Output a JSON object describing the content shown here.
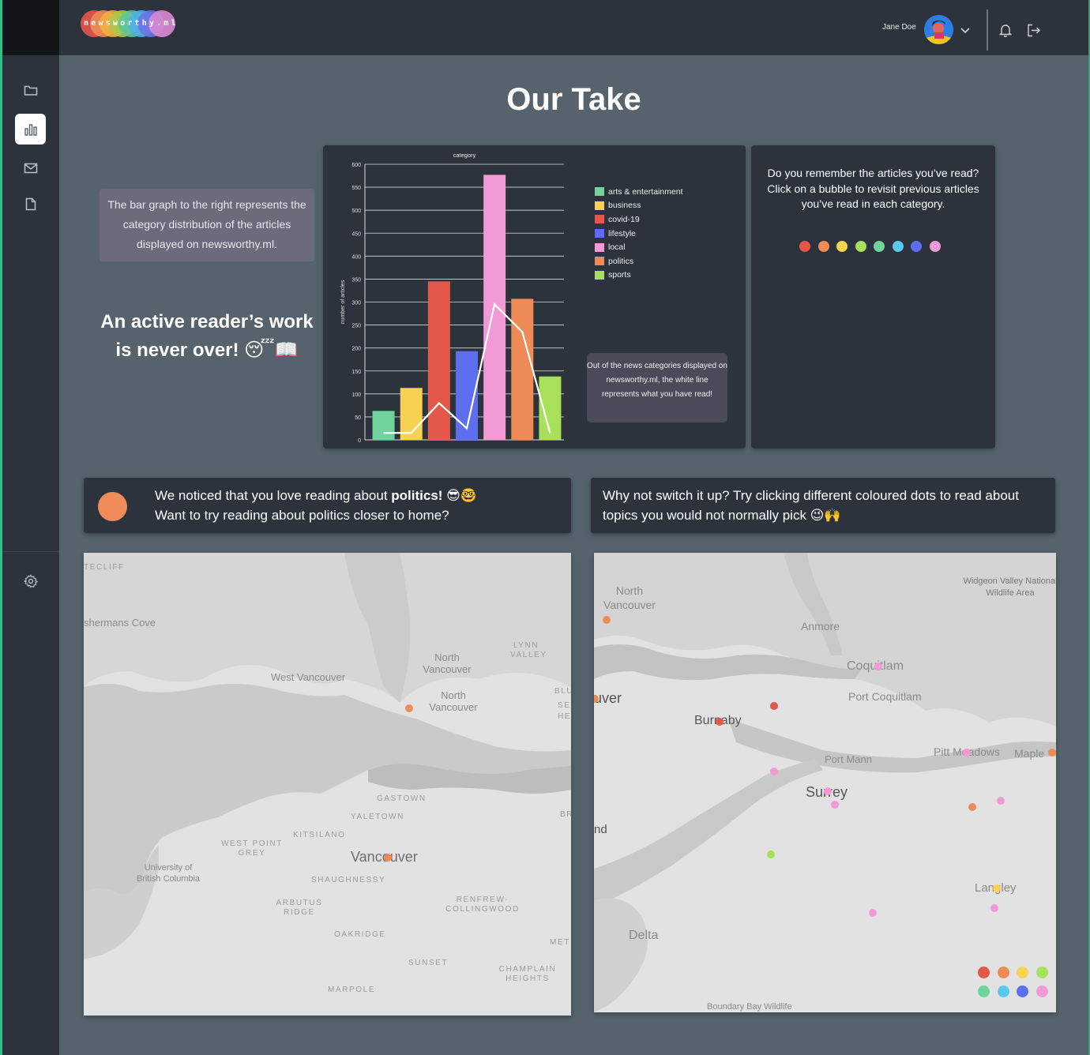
{
  "app": {
    "logo_text": "newsworthy.ml"
  },
  "header": {
    "user_name": "Jane Doe"
  },
  "sidebar": {
    "items": [
      "folder-icon",
      "bar-chart-icon",
      "mail-icon",
      "file-icon",
      "gear-icon"
    ],
    "active": "bar-chart-icon"
  },
  "page": {
    "title": "Our Take"
  },
  "explain": {
    "text": "The bar graph to the right represents the category distribution of the articles displayed on newsworthy.ml."
  },
  "reader": {
    "text": "An active reader’s work is never over! 😴📖"
  },
  "chart_note": {
    "text": "Out of the news categories displayed on newsworthy.ml, the white line represents what you have read!"
  },
  "chart_data": {
    "type": "bar",
    "title": "category",
    "xlabel": "",
    "ylabel": "number of articles",
    "ylim": [
      0,
      600
    ],
    "yticks": [
      0,
      50,
      100,
      150,
      200,
      250,
      300,
      350,
      400,
      450,
      500,
      550,
      600
    ],
    "categories": [
      "arts & entertainment",
      "business",
      "covid-19",
      "lifestyle",
      "local",
      "politics",
      "sports"
    ],
    "series": [
      {
        "values": [
          63,
          113,
          345,
          193,
          577,
          307,
          138
        ],
        "colors": [
          "#6fd39b",
          "#f8d353",
          "#e4574b",
          "#5b6ff0",
          "#f29ad5",
          "#ee8b57",
          "#a8e05a"
        ]
      },
      {
        "values": [
          15,
          15,
          80,
          25,
          295,
          235,
          15
        ],
        "color": "#ffffff"
      }
    ],
    "legend": [
      "arts & entertainment",
      "business",
      "covid-19",
      "lifestyle",
      "local",
      "politics",
      "sports"
    ],
    "legend_position": "right",
    "grid": true
  },
  "bubble_card": {
    "text": "Do you remember the articles you’ve read? Click on a bubble to revisit previous articles you’ve read in each category.",
    "colors": [
      "#e4574b",
      "#ee8b57",
      "#f8d353",
      "#a8e05a",
      "#6fd39b",
      "#5bc8f0",
      "#5b6ff0",
      "#f29ad5"
    ]
  },
  "notice_left": {
    "line1_pre": "We noticed that you love reading about ",
    "line1_bold": "politics!",
    "line1_emoji": " 😎🤓",
    "line2": "Want to try reading about politics closer to home?"
  },
  "notice_right": {
    "text": "Why not switch it up? Try clicking different coloured dots to read about topics you would not normally pick 😉🙌"
  },
  "map_left": {
    "labels": [
      "TECLIFF",
      "shermans Cove",
      "West Vancouver",
      "North Vancouver",
      "North Vancouver",
      "LYNN VALLEY",
      "BLU",
      "SE",
      "HE",
      "GASTOWN",
      "YALETOWN",
      "KITSILANO",
      "WEST POINT GREY",
      "University of British Columbia",
      "Vancouver",
      "SHAUGHNESSY",
      "ARBUTUS RIDGE",
      "RENFREW-COLLINGWOOD",
      "OAKRIDGE",
      "SUNSET",
      "CHAMPLAIN HEIGHTS",
      "MARPOLE",
      "MET",
      "BR"
    ]
  },
  "map_right": {
    "labels": [
      "North Vancouver",
      "Widgeon Valley National Wildlife Area",
      "Anmore",
      "Coquitlam",
      "Port Coquitlam",
      "uver",
      "Burnaby",
      "Port Mann",
      "Pitt Meadows",
      "Maple",
      "Surrey",
      "nd",
      "Langley",
      "Delta",
      "Boundary Bay Wildlife"
    ],
    "legend_colors": [
      "#e4574b",
      "#ee8b57",
      "#f8d353",
      "#a8e05a",
      "#6fd39b",
      "#5bc8f0",
      "#5b6ff0",
      "#f29ad5"
    ]
  }
}
